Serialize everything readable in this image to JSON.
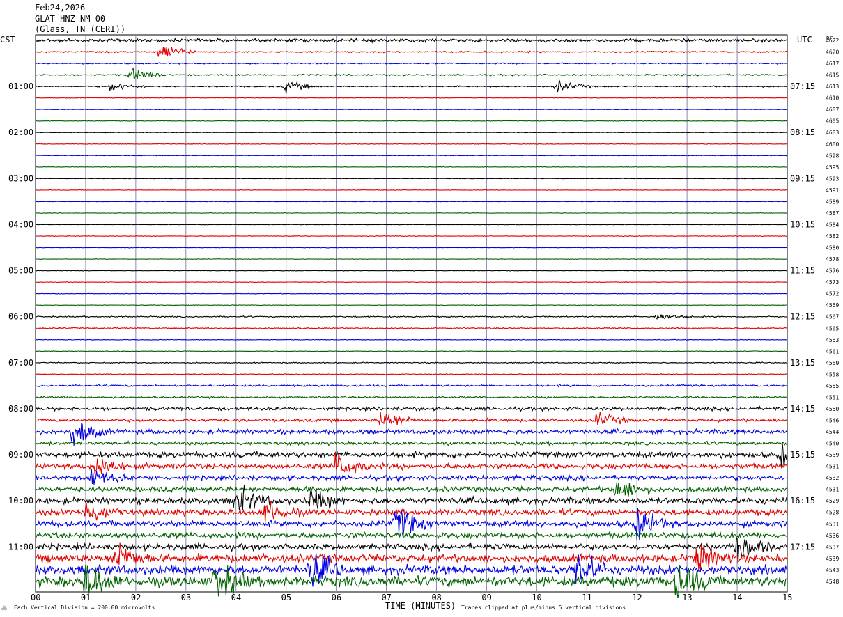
{
  "header": {
    "date": "Feb24,2026",
    "station": "GLAT HNZ NM 00",
    "location": "(Glass, TN (CERI))"
  },
  "labels": {
    "left_tz": "CST",
    "right_tz": "UTC",
    "dc_label": "DC",
    "x_title": "TIME (MINUTES)",
    "footer_left": "Each Vertical Division =  200.00 microvolts",
    "footer_right": "Traces clipped at plus/minus 5 vertical divisions"
  },
  "colors": {
    "trace_cycle": [
      "#000000",
      "#e00000",
      "#0000e0",
      "#006000"
    ],
    "grid": "#8a8aa8"
  },
  "chart_data": {
    "type": "line",
    "title": "GLAT HNZ NM 00",
    "xlabel": "TIME (MINUTES)",
    "xlim": [
      0,
      15
    ],
    "x_ticks": [
      "00",
      "01",
      "02",
      "03",
      "04",
      "05",
      "06",
      "07",
      "08",
      "09",
      "10",
      "11",
      "12",
      "13",
      "14",
      "15"
    ],
    "rows_per_hour": 4,
    "minutes_per_row": 15,
    "row_count": 48,
    "left_hour_labels": [
      "01:00",
      "02:00",
      "03:00",
      "04:00",
      "05:00",
      "06:00",
      "07:00",
      "08:00",
      "09:00",
      "10:00",
      "11:00"
    ],
    "right_hour_labels": [
      "07:15",
      "08:15",
      "09:15",
      "10:15",
      "11:15",
      "12:15",
      "13:15",
      "14:15",
      "15:15",
      "16:15",
      "17:15"
    ],
    "dc_offsets": [
      4622,
      4620,
      4617,
      4615,
      4613,
      4610,
      4607,
      4605,
      4603,
      4600,
      4598,
      4595,
      4593,
      4591,
      4589,
      4587,
      4584,
      4582,
      4580,
      4578,
      4576,
      4573,
      4572,
      4569,
      4567,
      4565,
      4563,
      4561,
      4559,
      4558,
      4555,
      4551,
      4550,
      4546,
      4544,
      4540,
      4539,
      4531,
      4532,
      4531,
      4529,
      4528,
      4531,
      4536,
      4537,
      4539,
      4543,
      4548
    ],
    "row_noise_level": [
      1.6,
      0.7,
      0.6,
      0.7,
      0.6,
      0.25,
      0.25,
      0.25,
      0.25,
      0.25,
      0.25,
      0.25,
      0.25,
      0.25,
      0.25,
      0.25,
      0.25,
      0.3,
      0.25,
      0.25,
      0.25,
      0.25,
      0.25,
      0.25,
      0.6,
      0.6,
      0.3,
      0.3,
      0.5,
      0.4,
      0.9,
      0.9,
      1.6,
      1.5,
      2.2,
      1.7,
      2.8,
      2.6,
      2.2,
      2.4,
      3.2,
      3.0,
      3.0,
      2.8,
      3.0,
      4.0,
      4.5,
      5.0
    ],
    "events": [
      {
        "row": 1,
        "minute": 2.5,
        "amp": 10
      },
      {
        "row": 3,
        "minute": 1.9,
        "amp": 7
      },
      {
        "row": 4,
        "minute": 1.5,
        "amp": 5
      },
      {
        "row": 4,
        "minute": 5.0,
        "amp": 6
      },
      {
        "row": 4,
        "minute": 10.4,
        "amp": 6
      },
      {
        "row": 24,
        "minute": 12.4,
        "amp": 4
      },
      {
        "row": 33,
        "minute": 6.9,
        "amp": 12
      },
      {
        "row": 33,
        "minute": 11.2,
        "amp": 8
      },
      {
        "row": 34,
        "minute": 0.75,
        "amp": 16
      },
      {
        "row": 36,
        "minute": 14.9,
        "amp": 12
      },
      {
        "row": 37,
        "minute": 1.2,
        "amp": 14
      },
      {
        "row": 37,
        "minute": 6.0,
        "amp": 16
      },
      {
        "row": 38,
        "minute": 1.1,
        "amp": 10
      },
      {
        "row": 39,
        "minute": 11.6,
        "amp": 14
      },
      {
        "row": 40,
        "minute": 4.0,
        "amp": 16
      },
      {
        "row": 40,
        "minute": 5.5,
        "amp": 12
      },
      {
        "row": 41,
        "minute": 1.0,
        "amp": 12
      },
      {
        "row": 41,
        "minute": 4.6,
        "amp": 14
      },
      {
        "row": 42,
        "minute": 7.2,
        "amp": 16
      },
      {
        "row": 42,
        "minute": 12.0,
        "amp": 16
      },
      {
        "row": 44,
        "minute": 14.0,
        "amp": 14
      },
      {
        "row": 45,
        "minute": 1.6,
        "amp": 18
      },
      {
        "row": 45,
        "minute": 13.2,
        "amp": 16
      },
      {
        "row": 46,
        "minute": 5.5,
        "amp": 20
      },
      {
        "row": 46,
        "minute": 10.8,
        "amp": 20
      },
      {
        "row": 47,
        "minute": 1.0,
        "amp": 22
      },
      {
        "row": 47,
        "minute": 3.6,
        "amp": 20
      },
      {
        "row": 47,
        "minute": 12.8,
        "amp": 22
      }
    ]
  }
}
